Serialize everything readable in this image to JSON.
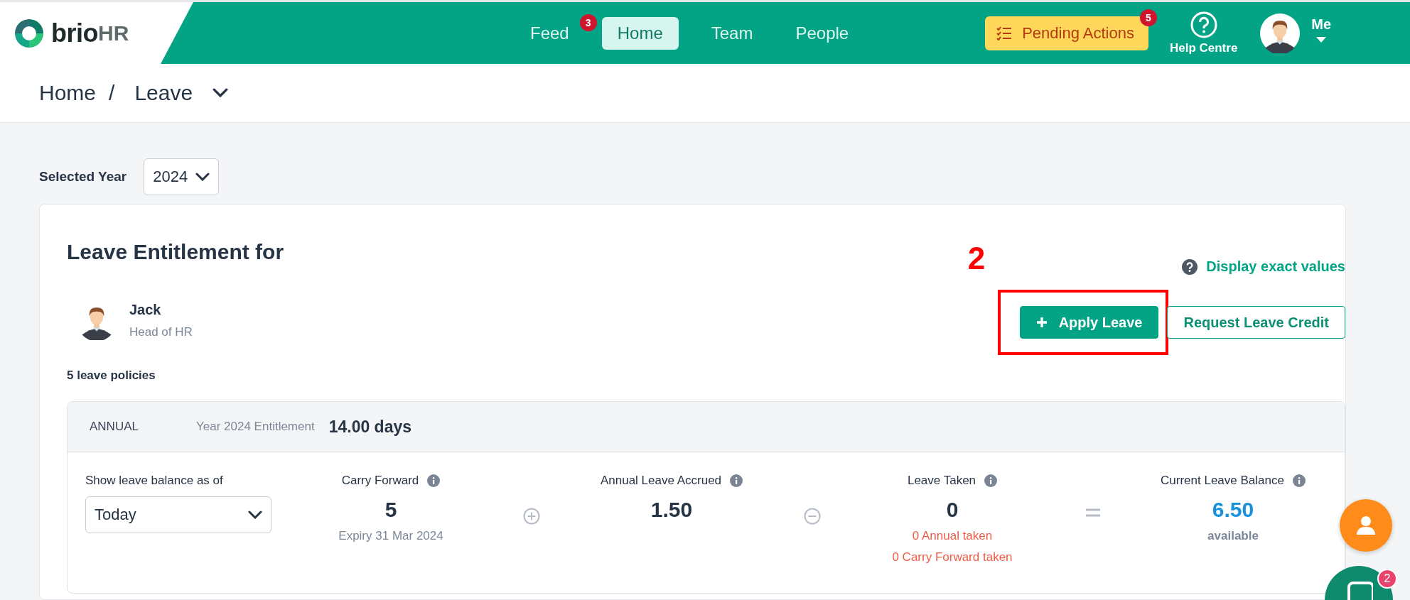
{
  "header": {
    "logo": {
      "word": "brio",
      "suffix": "HR"
    },
    "nav": [
      {
        "label": "Feed",
        "badge": "3",
        "selected": false
      },
      {
        "label": "Home",
        "selected": true
      },
      {
        "label": "Team",
        "selected": false
      },
      {
        "label": "People",
        "selected": false
      }
    ],
    "pending_actions": {
      "label": "Pending Actions",
      "badge": "5"
    },
    "help": {
      "label": "Help Centre"
    },
    "user": {
      "label": "Me"
    }
  },
  "breadcrumb": {
    "items": [
      "Home",
      "Leave"
    ],
    "separator": "/"
  },
  "year_filter": {
    "label": "Selected Year",
    "value": "2024"
  },
  "entitlement": {
    "title": "Leave Entitlement for",
    "display_exact_values": "Display exact values",
    "employee": {
      "name": "Jack",
      "role": "Head of HR"
    },
    "buttons": [
      {
        "label": "Apply Leave",
        "kind": "primary",
        "annotation": "2"
      },
      {
        "label": "Request Leave Credit",
        "kind": "outline"
      }
    ],
    "policy_count": "5 leave policies",
    "policy": {
      "name": "ANNUAL",
      "entitlement_label": "Year 2024 Entitlement",
      "entitlement_value": "14.00 days",
      "balance_as_of": {
        "label": "Show leave balance as of",
        "value": "Today"
      },
      "items": [
        {
          "kind": "stat",
          "label": "Carry Forward",
          "value": "5",
          "color": "#273445",
          "notes": [
            {
              "text": "Expiry 31 Mar 2024",
              "color": "#7c8797"
            }
          ]
        },
        {
          "kind": "plus"
        },
        {
          "kind": "stat",
          "label": "Annual Leave Accrued",
          "value": "1.50",
          "color": "#273445"
        },
        {
          "kind": "minus"
        },
        {
          "kind": "stat",
          "label": "Leave Taken",
          "value": "0",
          "color": "#273445",
          "notes": [
            {
              "text": "0 Annual taken",
              "color": "#ef5b45"
            },
            {
              "text": "0 Carry Forward taken",
              "color": "#ef5b45"
            }
          ]
        },
        {
          "kind": "equals"
        },
        {
          "kind": "stat",
          "label": "Current Leave Balance",
          "value": "6.50",
          "color": "#1792db",
          "notes": [
            {
              "text": "available",
              "color": "#7c8797"
            }
          ]
        }
      ]
    }
  },
  "chat": {
    "badge": "2"
  }
}
